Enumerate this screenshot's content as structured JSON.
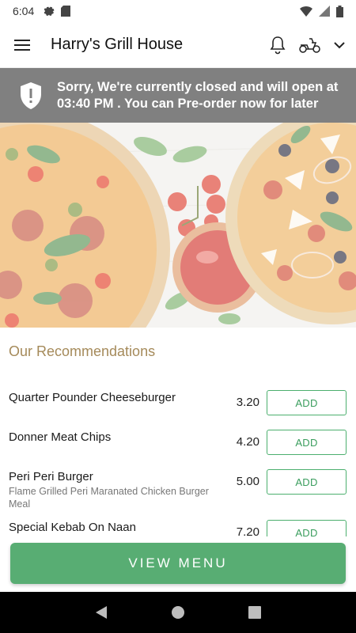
{
  "status_bar": {
    "time": "6:04",
    "icons_left": [
      "settings-icon",
      "sd-card-icon"
    ],
    "icons_right": [
      "wifi-icon",
      "signal-icon",
      "battery-icon"
    ]
  },
  "app_bar": {
    "title": "Harry's Grill House",
    "icons": [
      "menu-icon",
      "bell-icon",
      "scooter-icon",
      "chevron-down-icon"
    ]
  },
  "banner": {
    "message": "Sorry, We're currently closed and will open at 03:40 PM . You can Pre-order now for later",
    "icon": "shield-alert-icon"
  },
  "recommendations": {
    "title": "Our Recommendations",
    "add_label": "ADD",
    "items": [
      {
        "name": "Quarter Pounder Cheeseburger",
        "description": "",
        "price": "3.20"
      },
      {
        "name": "Donner Meat Chips",
        "description": "",
        "price": "4.20"
      },
      {
        "name": "Peri Peri Burger",
        "description": "Flame Grilled Peri Maranated Chicken Burger Meal",
        "price": "5.00"
      },
      {
        "name": "Special Kebab On Naan",
        "description": "",
        "price": "7.20"
      }
    ]
  },
  "view_menu_label": "VIEW MENU",
  "colors": {
    "accent_green": "#58ad73",
    "banner_gray": "#808080",
    "section_title": "#a58a5a"
  }
}
